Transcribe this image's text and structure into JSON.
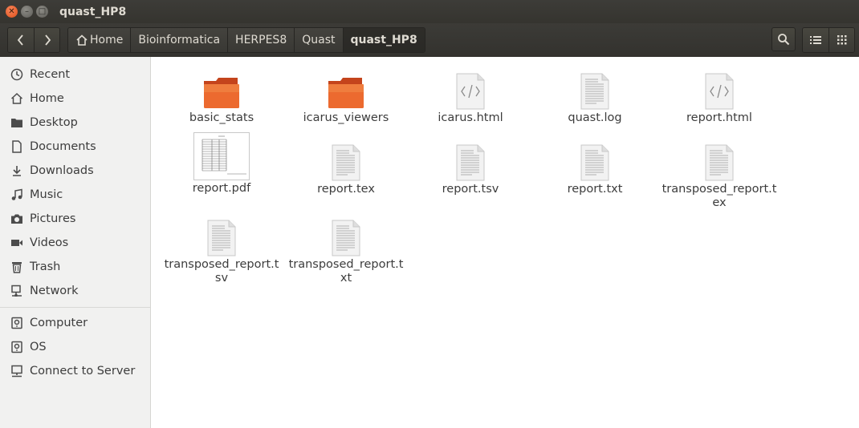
{
  "window": {
    "title": "quast_HP8"
  },
  "toolbar": {
    "back_icon": "chevron-left-icon",
    "forward_icon": "chevron-right-icon",
    "breadcrumbs": [
      "Home",
      "Bioinformatica",
      "HERPES8",
      "Quast",
      "quast_HP8"
    ],
    "search_icon": "search-icon",
    "list_view_icon": "list-view-icon",
    "grid_view_icon": "grid-view-icon"
  },
  "sidebar": {
    "places": [
      {
        "label": "Recent",
        "icon": "clock-icon"
      },
      {
        "label": "Home",
        "icon": "home-icon"
      },
      {
        "label": "Desktop",
        "icon": "folder-icon"
      },
      {
        "label": "Documents",
        "icon": "document-icon"
      },
      {
        "label": "Downloads",
        "icon": "download-icon"
      },
      {
        "label": "Music",
        "icon": "music-icon"
      },
      {
        "label": "Pictures",
        "icon": "camera-icon"
      },
      {
        "label": "Videos",
        "icon": "video-icon"
      },
      {
        "label": "Trash",
        "icon": "trash-icon"
      },
      {
        "label": "Network",
        "icon": "network-icon"
      }
    ],
    "devices": [
      {
        "label": "Computer",
        "icon": "drive-icon"
      },
      {
        "label": "OS",
        "icon": "drive-icon"
      },
      {
        "label": "Connect to Server",
        "icon": "server-icon"
      }
    ]
  },
  "files": [
    {
      "name": "basic_stats",
      "type": "folder"
    },
    {
      "name": "icarus_viewers",
      "type": "folder"
    },
    {
      "name": "icarus.html",
      "type": "html"
    },
    {
      "name": "quast.log",
      "type": "text"
    },
    {
      "name": "report.html",
      "type": "html"
    },
    {
      "name": "report.pdf",
      "type": "pdf"
    },
    {
      "name": "report.tex",
      "type": "text"
    },
    {
      "name": "report.tsv",
      "type": "text"
    },
    {
      "name": "report.txt",
      "type": "text"
    },
    {
      "name": "transposed_report.tex",
      "type": "text"
    },
    {
      "name": "transposed_report.tsv",
      "type": "text"
    },
    {
      "name": "transposed_report.txt",
      "type": "text"
    }
  ],
  "colors": {
    "folder": "#e9602b",
    "accent": "#e95420"
  }
}
